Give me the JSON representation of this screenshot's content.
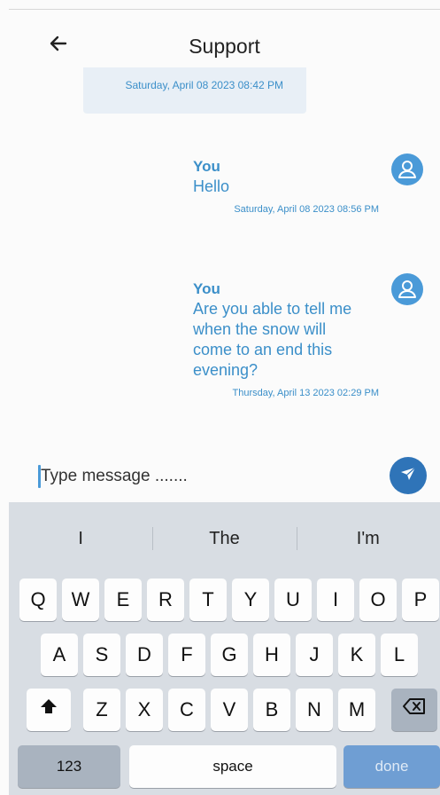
{
  "header": {
    "title": "Support",
    "back_icon": "arrow-left-icon"
  },
  "previous_message": {
    "timestamp": "Saturday, April 08 2023 08:42 PM"
  },
  "messages": [
    {
      "sender": "You",
      "text": "Hello",
      "timestamp": "Saturday, April 08 2023 08:56 PM",
      "avatar": "user-icon"
    },
    {
      "sender": "You",
      "text": "Are you able to tell me when the snow will come to an end this evening?",
      "timestamp": "Thursday, April 13 2023 02:29 PM",
      "avatar": "user-icon"
    }
  ],
  "composer": {
    "placeholder": "Type message .......",
    "value": "",
    "send_icon": "send-icon"
  },
  "keyboard": {
    "suggestions": [
      "I",
      "The",
      "I'm"
    ],
    "row1": [
      "Q",
      "W",
      "E",
      "R",
      "T",
      "Y",
      "U",
      "I",
      "O",
      "P"
    ],
    "row2": [
      "A",
      "S",
      "D",
      "F",
      "G",
      "H",
      "J",
      "K",
      "L"
    ],
    "row3": [
      "Z",
      "X",
      "C",
      "V",
      "B",
      "N",
      "M"
    ],
    "numbers_label": "123",
    "space_label": "space",
    "done_label": "done",
    "shift_icon": "shift-icon",
    "backspace_icon": "backspace-icon"
  },
  "colors": {
    "accent": "#3b8fc9",
    "send_button": "#2f74b8",
    "keyboard_bg": "#d8dde3"
  }
}
